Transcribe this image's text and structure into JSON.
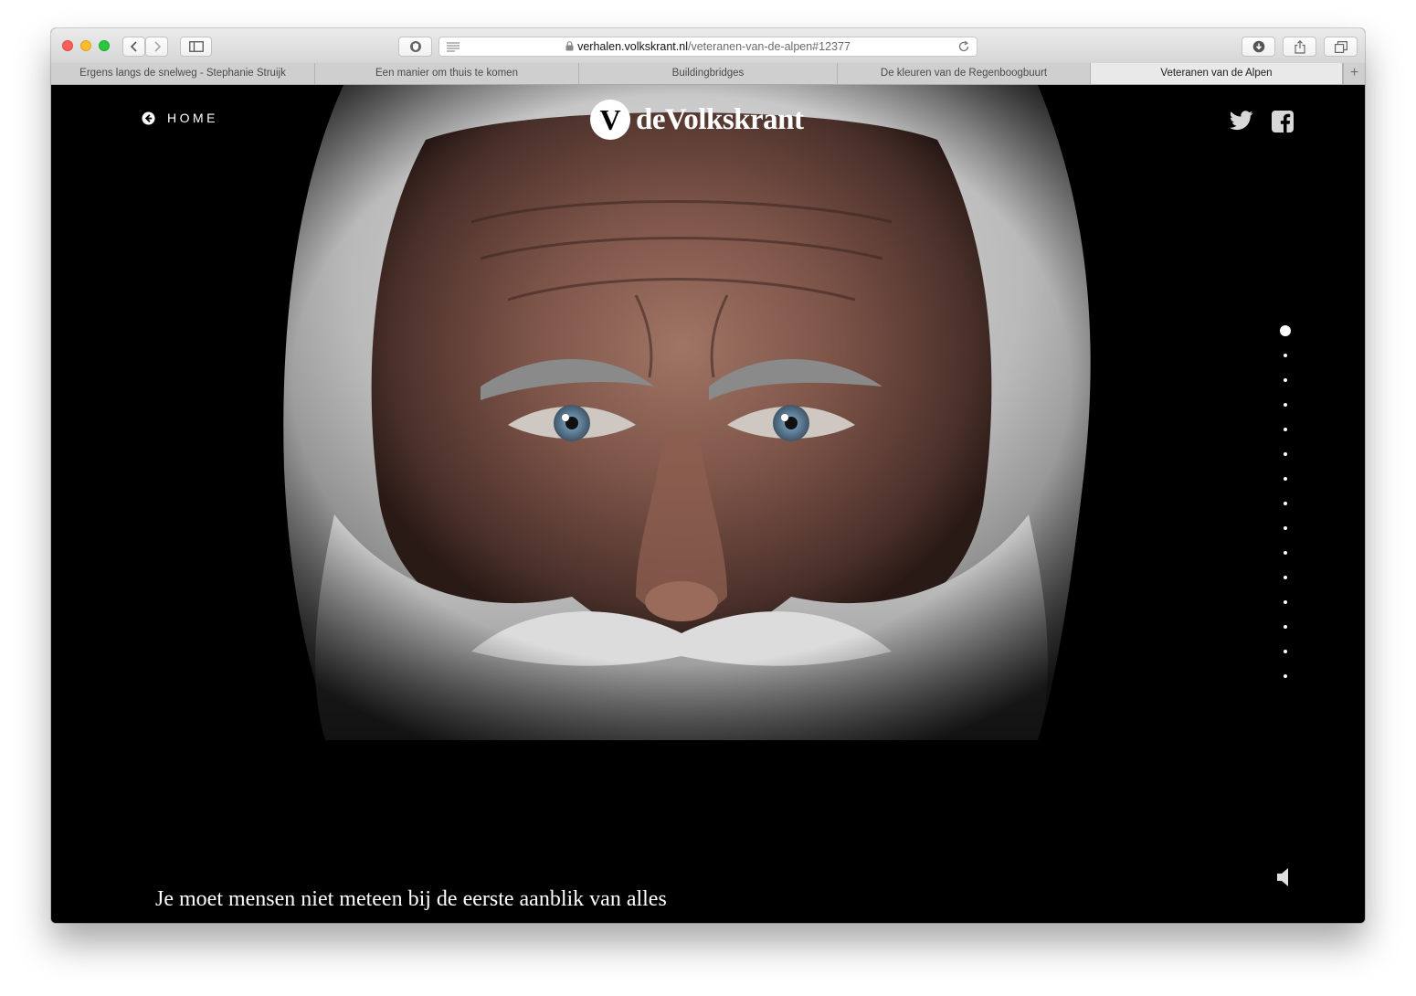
{
  "browser": {
    "url_host": "verhalen.volkskrant.nl",
    "url_path": "/veteranen-van-de-alpen#12377",
    "tabs": [
      {
        "label": "Ergens langs de snelweg - Stephanie Struijk",
        "active": false
      },
      {
        "label": "Een manier om thuis te komen",
        "active": false
      },
      {
        "label": "Buildingbridges",
        "active": false
      },
      {
        "label": "De kleuren van de Regenboogbuurt",
        "active": false
      },
      {
        "label": "Veteranen van de Alpen",
        "active": true
      }
    ],
    "new_tab_label": "+"
  },
  "page": {
    "home_label": "HOME",
    "logo_letter": "V",
    "logo_text": "deVolkskrant",
    "caption": "Je moet mensen niet meteen bij de eerste aanblik van alles",
    "slide_count": 15,
    "active_slide": 1
  },
  "icons": {
    "home": "arrow-left-circle-icon",
    "twitter": "twitter-icon",
    "facebook": "facebook-icon",
    "sound": "speaker-icon"
  },
  "colors": {
    "page_background": "#000000",
    "text": "#ffffff"
  }
}
